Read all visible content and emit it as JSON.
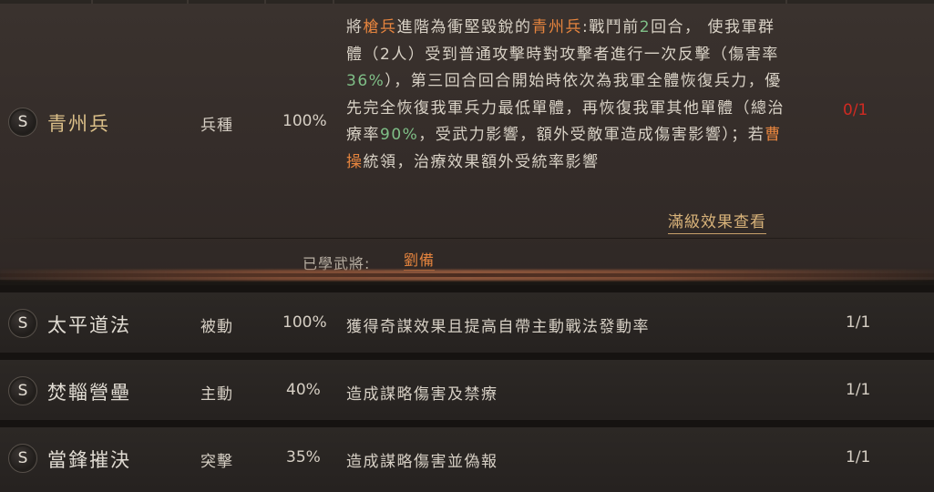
{
  "expanded": {
    "badge": "S",
    "name": "青州兵",
    "type": "兵種",
    "rate": "100%",
    "count": "0/1",
    "desc": [
      {
        "text": "將",
        "hl": ""
      },
      {
        "text": "槍兵",
        "hl": "orange"
      },
      {
        "text": "進階為衝堅毀銳的",
        "hl": ""
      },
      {
        "text": "青州兵",
        "hl": "orange"
      },
      {
        "text": ":戰鬥前",
        "hl": ""
      },
      {
        "text": "2",
        "hl": "green"
      },
      {
        "text": "回合， 使我軍群體（2人）受到普通攻擊時對攻擊者進行一次反擊（傷害率",
        "hl": ""
      },
      {
        "text": "36%",
        "hl": "green"
      },
      {
        "text": "），第三回合回合開始時依次為我軍全體恢復兵力，優先完全恢復我軍兵力最低單體，再恢復我軍其他單體（總治療率",
        "hl": ""
      },
      {
        "text": "90%",
        "hl": "green"
      },
      {
        "text": "，受武力影響，額外受敵軍造成傷害影響）；若",
        "hl": ""
      },
      {
        "text": "曹操",
        "hl": "orange"
      },
      {
        "text": "統領，治療效果額外受統率影響",
        "hl": ""
      }
    ],
    "full_effect_link": "滿級效果查看",
    "learned_label": "已學武將:",
    "learned_general": "劉備"
  },
  "rows": [
    {
      "badge": "S",
      "name": "太平道法",
      "type": "被動",
      "rate": "100%",
      "desc": "獲得奇謀效果且提高自帶主動戰法發動率",
      "count": "1/1"
    },
    {
      "badge": "S",
      "name": "焚輜營壘",
      "type": "主動",
      "rate": "40%",
      "desc": "造成謀略傷害及禁療",
      "count": "1/1"
    },
    {
      "badge": "S",
      "name": "當鋒摧決",
      "type": "突擊",
      "rate": "35%",
      "desc": "造成謀略傷害並偽報",
      "count": "1/1"
    }
  ],
  "colors": {
    "name_expanded": "#dcc089",
    "name_row": "#e0dbd2",
    "count_unlearned": "#d02a22",
    "highlight_orange": "#e5843e",
    "highlight_green": "#7fbf87"
  }
}
